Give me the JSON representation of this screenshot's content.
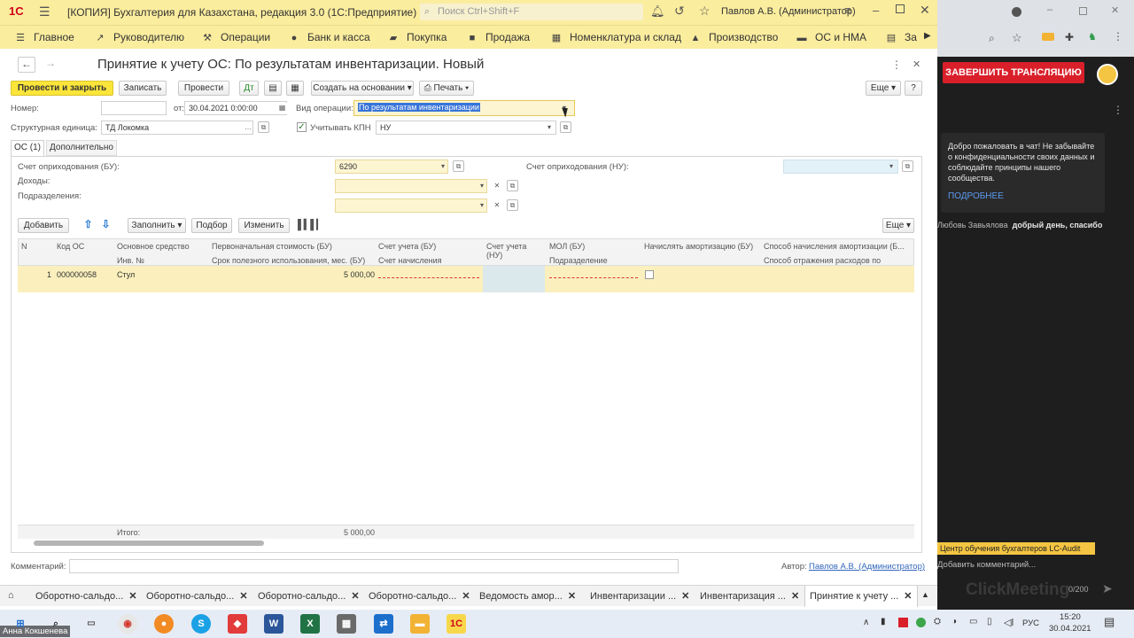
{
  "app": {
    "logo": "1С",
    "title": "[КОПИЯ] Бухгалтерия для Казахстана, редакция 3.0 (1С:Предприятие)",
    "search_placeholder": "Поиск Ctrl+Shift+F",
    "user": "Павлов А.В. (Администратор)"
  },
  "menu": [
    {
      "icon": "menu-icon",
      "label": "Главное"
    },
    {
      "icon": "trend-icon",
      "label": "Руководителю"
    },
    {
      "icon": "hammer-icon",
      "label": "Операции"
    },
    {
      "icon": "coin-icon",
      "label": "Банк и касса"
    },
    {
      "icon": "cart-icon",
      "label": "Покупка"
    },
    {
      "icon": "bag-icon",
      "label": "Продажа"
    },
    {
      "icon": "warehouse-icon",
      "label": "Номенклатура и склад"
    },
    {
      "icon": "factory-icon",
      "label": "Производство"
    },
    {
      "icon": "truck-icon",
      "label": "ОС и НМА"
    },
    {
      "icon": "more-icon",
      "label": "За"
    }
  ],
  "form": {
    "title": "Принятие к учету ОС: По результатам инвентаризации. Новый",
    "buttons": {
      "post_close": "Провести и закрыть",
      "save": "Записать",
      "post": "Провести",
      "create_based": "Создать на основании",
      "print": "Печать",
      "more": "Еще",
      "help": "?"
    },
    "number_label": "Номер:",
    "number_value": "",
    "from_label": "от:",
    "date_value": "30.04.2021  0:00:00",
    "operation_label": "Вид операции:",
    "operation_value": "По результатам инвентаризации",
    "unit_label": "Структурная единица:",
    "unit_value": "ТД Локомка",
    "kpn_label": "Учитывать КПН",
    "kpn_checked": true,
    "kpn_value": "НУ",
    "tabs": [
      "ОС (1)",
      "Дополнительно"
    ],
    "account_bu_label": "Счет оприходования (БУ):",
    "account_bu_value": "6290",
    "income_label": "Доходы:",
    "dept_label": "Подразделения:",
    "account_nu_label": "Счет оприходования (НУ):",
    "table_buttons": {
      "add": "Добавить",
      "fill": "Заполнить",
      "pick": "Подбор",
      "edit": "Изменить",
      "more": "Еще"
    },
    "columns_top": [
      "N",
      "Код ОС",
      "Основное средство",
      "Первоначальная стоимость (БУ)",
      "Счет учета (БУ)",
      "Счет учета",
      "МОЛ (БУ)",
      "Начислять амортизацию (БУ)",
      "Способ начисления амортизации (Б..."
    ],
    "columns_bottom": [
      "",
      "",
      "Инв. №",
      "Срок полезного использования, мес. (БУ)",
      "Счет начисления",
      "(НУ)",
      "Подразделение",
      "",
      "Способ отражения расходов по"
    ],
    "rows": [
      {
        "n": "1",
        "code": "000000058",
        "name": "Стул",
        "cost": "5 000,00"
      }
    ],
    "total_label": "Итого:",
    "total_value": "5 000,00",
    "comment_label": "Комментарий:",
    "author_label": "Автор:",
    "author_value": "Павлов А.В. (Администратор)"
  },
  "tabs_bottom": [
    "Оборотно-сальдо...",
    "Оборотно-сальдо...",
    "Оборотно-сальдо...",
    "Оборотно-сальдо...",
    "Ведомость амор...",
    "Инвентаризации ...",
    "Инвентаризация ...",
    "Принятие к учету ..."
  ],
  "right_panel": {
    "end_stream": "ЗАВЕРШИТЬ ТРАНСЛЯЦИЮ",
    "welcome": "Добро пожаловать в чат! Не забывайте о конфиденциальности своих данных и соблюдайте принципы нашего сообщества.",
    "more_link": "ПОДРОБНЕЕ",
    "message_author": "Любовь Завьялова",
    "message_text": "добрый день, спасибо",
    "channel": "Центр обучения бухгалтеров LC-Audit",
    "add_comment": "Добавить комментарий...",
    "counter": "0/200",
    "brand": "ClickMeeting"
  },
  "taskbar": {
    "user_overlay": "Анна Кокшенева",
    "lang": "РУС",
    "time": "15:20",
    "date": "30.04.2021"
  },
  "colors": {
    "header_yellow": "#fbed9e",
    "primary_button": "#fce53a",
    "end_stream_red": "#d9202a",
    "selection_blue": "#3874d8"
  }
}
